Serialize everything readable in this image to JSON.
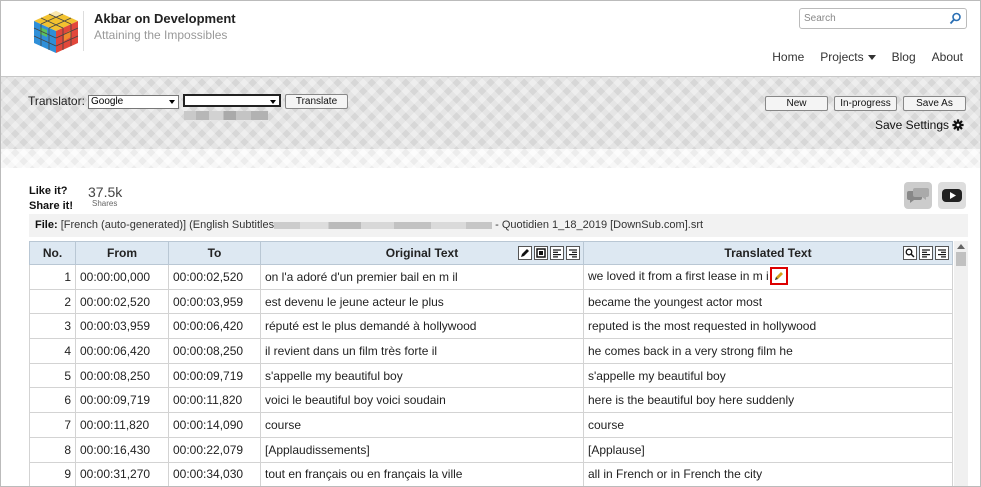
{
  "site": {
    "title": "Akbar on Development",
    "tagline": "Attaining the Impossibles"
  },
  "search": {
    "placeholder": "Search"
  },
  "nav": {
    "items": [
      "Home",
      "Projects",
      "Blog",
      "About"
    ]
  },
  "toolbar": {
    "translator_label": "Translator:",
    "engine_selected": "Google",
    "language_selected": "",
    "translate_button": "Translate",
    "new_button": "New",
    "inprogress_button": "In-progress",
    "saveas_button": "Save As",
    "save_settings": "Save Settings"
  },
  "social": {
    "like": "Like it?",
    "share": "Share it!",
    "shares_count": "37.5k",
    "shares_label": "Shares"
  },
  "file": {
    "label": "File:",
    "prefix": "[French (auto-generated)] (English Subtitles",
    "suffix": "- Quotidien 1_18_2019 [DownSub.com].srt"
  },
  "table": {
    "headers": [
      "No.",
      "From",
      "To",
      "Original Text",
      "Translated Text"
    ],
    "rows": [
      {
        "no": "1",
        "from": "00:00:00,000",
        "to": "00:00:02,520",
        "original": "on l'a adoré d'un premier bail en m il",
        "translated": "we loved it from a first lease in m i"
      },
      {
        "no": "2",
        "from": "00:00:02,520",
        "to": "00:00:03,959",
        "original": "est devenu le jeune acteur le plus",
        "translated": "became the youngest actor most"
      },
      {
        "no": "3",
        "from": "00:00:03,959",
        "to": "00:00:06,420",
        "original": "réputé est le plus demandé à hollywood",
        "translated": "reputed is the most requested in hollywood"
      },
      {
        "no": "4",
        "from": "00:00:06,420",
        "to": "00:00:08,250",
        "original": "il revient dans un film très forte il",
        "translated": "he comes back in a very strong film he"
      },
      {
        "no": "5",
        "from": "00:00:08,250",
        "to": "00:00:09,719",
        "original": "s'appelle my beautiful boy",
        "translated": "s'appelle my beautiful boy"
      },
      {
        "no": "6",
        "from": "00:00:09,719",
        "to": "00:00:11,820",
        "original": "voici le beautiful boy voici soudain",
        "translated": "here is the beautiful boy here suddenly"
      },
      {
        "no": "7",
        "from": "00:00:11,820",
        "to": "00:00:14,090",
        "original": "course",
        "translated": "course"
      },
      {
        "no": "8",
        "from": "00:00:16,430",
        "to": "00:00:22,079",
        "original": "[Applaudissements]",
        "translated": "[Applause]"
      },
      {
        "no": "9",
        "from": "00:00:31,270",
        "to": "00:00:34,030",
        "original": "tout en français ou en français la ville",
        "translated": "all in French or in French the city"
      }
    ]
  },
  "colors": {
    "header_bg": "#dde8f2",
    "highlight": "#dd0000",
    "youtube": "#222222"
  }
}
